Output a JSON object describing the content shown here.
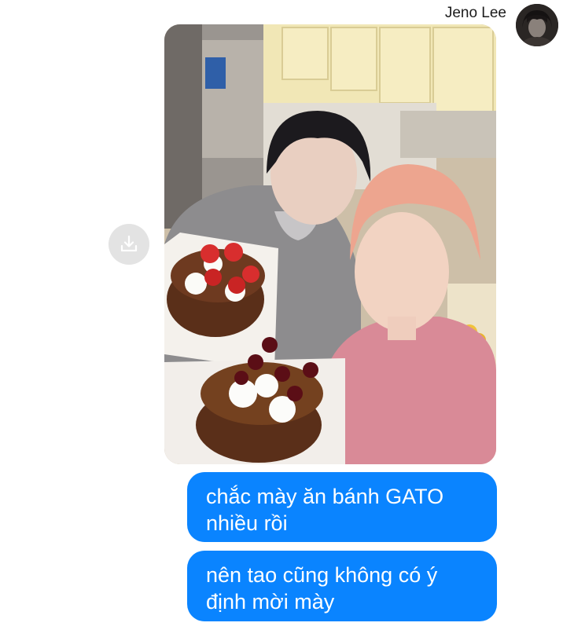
{
  "conversation": {
    "sender_name": "Jeno Lee",
    "avatar_icon": "user-avatar",
    "messages": [
      {
        "type": "image",
        "alt_icon": "photo-kitchen-cakes"
      },
      {
        "type": "text",
        "text": "chắc mày ăn bánh GATO nhiều rồi"
      },
      {
        "type": "text",
        "text": "nên tao cũng không có ý định mời mày"
      }
    ],
    "download_icon": "download-icon"
  },
  "colors": {
    "bubble_bg": "#0a84ff",
    "bubble_text": "#ffffff",
    "download_bg": "#e3e3e3",
    "background": "#ffffff"
  }
}
